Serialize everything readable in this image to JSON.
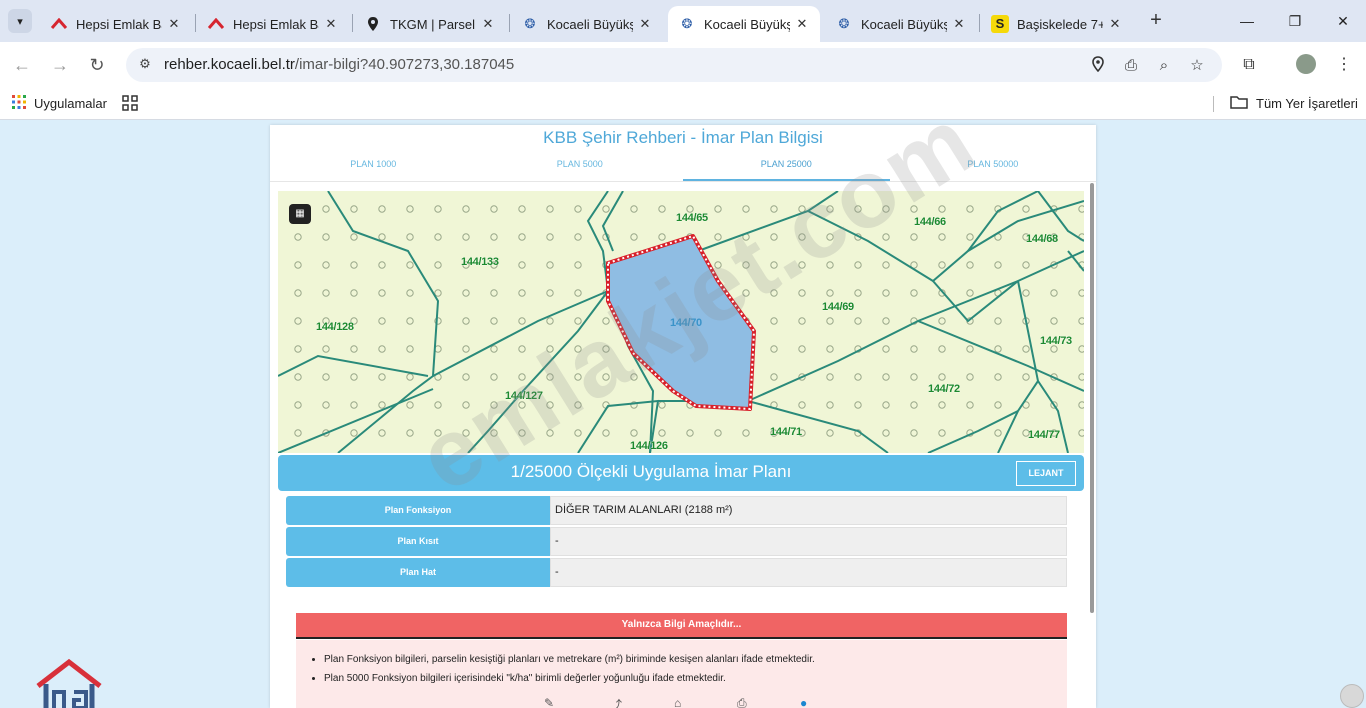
{
  "browser": {
    "tabs": [
      {
        "title": "Hepsi Emlak Ba",
        "icon": "hepsiemlak-icon"
      },
      {
        "title": "Hepsi Emlak Ba",
        "icon": "hepsiemlak-icon"
      },
      {
        "title": "TKGM | Parsel S",
        "icon": "map-pin-icon"
      },
      {
        "title": "Kocaeli Büyükş",
        "icon": "kocaeli-icon"
      },
      {
        "title": "Kocaeli Büyükş",
        "icon": "kocaeli-icon",
        "active": true
      },
      {
        "title": "Kocaeli Büyükş",
        "icon": "kocaeli-icon"
      },
      {
        "title": "Başiskelede 7+",
        "icon": "sahibinden-icon"
      }
    ],
    "url_domain": "rehber.kocaeli.bel.tr",
    "url_path": "/imar-bilgi?40.907273,30.187045",
    "bookmarks": {
      "apps": "Uygulamalar",
      "all_bookmarks": "Tüm Yer İşaretleri"
    }
  },
  "page": {
    "title": "KBB Şehir Rehberi - İmar Plan Bilgisi",
    "tabs": [
      "PLAN 1000",
      "PLAN 5000",
      "PLAN 25000",
      "PLAN 50000"
    ],
    "active_tab": "PLAN 25000",
    "map": {
      "parcels": [
        "144/65",
        "144/66",
        "144/68",
        "144/133",
        "144/128",
        "144/70",
        "144/69",
        "144/73",
        "144/127",
        "144/72",
        "144/71",
        "144/126",
        "144/77"
      ],
      "selected_parcel": "144/70"
    },
    "scale_title": "1/25000 Ölçekli Uygulama İmar Planı",
    "legend_button": "LEJANT",
    "info": [
      {
        "label": "Plan Fonksiyon",
        "value": "DİĞER TARIM ALANLARI (2188 m²)"
      },
      {
        "label": "Plan Kısıt",
        "value": "-"
      },
      {
        "label": "Plan Hat",
        "value": "-"
      }
    ],
    "notice_title": "Yalnızca Bilgi Amaçlıdır...",
    "notices": [
      "Plan Fonksiyon bilgileri, parselin kesiştiği planları ve metrekare (m²) biriminde kesişen alanları ifade etmektedir.",
      "Plan 5000 Fonksiyon bilgileri içerisindeki \"k/ha\" birimli değerler yoğunluğu ifade etmektedir."
    ],
    "watermark": "emlakjet.com"
  },
  "colors": {
    "accent": "#5dbde8",
    "notice_red": "#f06464",
    "map_bg": "#f0f6d6",
    "parcel_line": "#2a8a7a",
    "selected_fill": "#8fbde3",
    "selected_border": "#d8202a"
  }
}
